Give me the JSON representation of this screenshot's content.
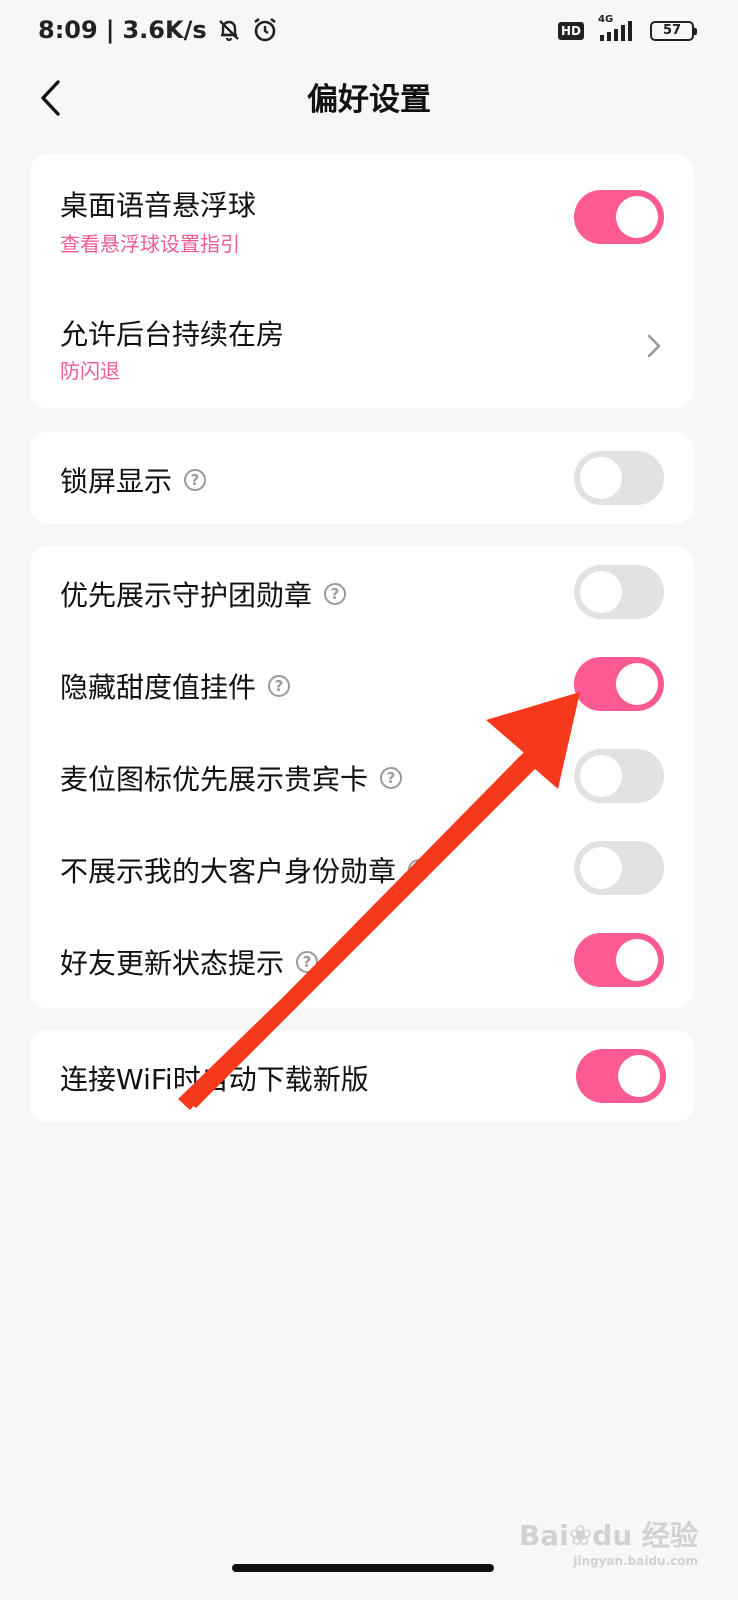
{
  "status_bar": {
    "time": "8:09",
    "separator": "|",
    "net_speed": "3.6K/s",
    "hd_label": "HD",
    "signal_type": "4G",
    "battery": "57",
    "icons": [
      "mute-bell-icon",
      "alarm-icon",
      "signal-icon",
      "battery-icon"
    ]
  },
  "header": {
    "title": "偏好设置",
    "back_icon": "chevron-left-icon"
  },
  "settings": {
    "floating_ball": {
      "title": "桌面语音悬浮球",
      "subtitle": "查看悬浮球设置指引",
      "enabled": true
    },
    "background_stay": {
      "title": "允许后台持续在房",
      "subtitle": "防闪退"
    },
    "lock_screen": {
      "title": "锁屏显示",
      "enabled": false
    },
    "guard_badge": {
      "title": "优先展示守护团勋章",
      "enabled": false
    },
    "hide_sweetness": {
      "title": "隐藏甜度值挂件",
      "enabled": true
    },
    "vip_card": {
      "title": "麦位图标优先展示贵宾卡",
      "enabled": false
    },
    "big_customer": {
      "title": "不展示我的大客户身份勋章",
      "enabled": false
    },
    "friend_status": {
      "title": "好友更新状态提示",
      "enabled": true
    },
    "wifi_update": {
      "title": "连接WiFi时自动下载新版",
      "enabled": true
    }
  },
  "watermark": {
    "brand": "Bai",
    "brand_suffix": "du",
    "product": "经验",
    "url": "jingyan.baidu.com"
  },
  "colors": {
    "accent": "#fb5a93",
    "subtitle": "#ef5b93",
    "toggle_off": "#e2e2e2",
    "background": "#f7f7f7",
    "arrow": "#f5391c"
  }
}
